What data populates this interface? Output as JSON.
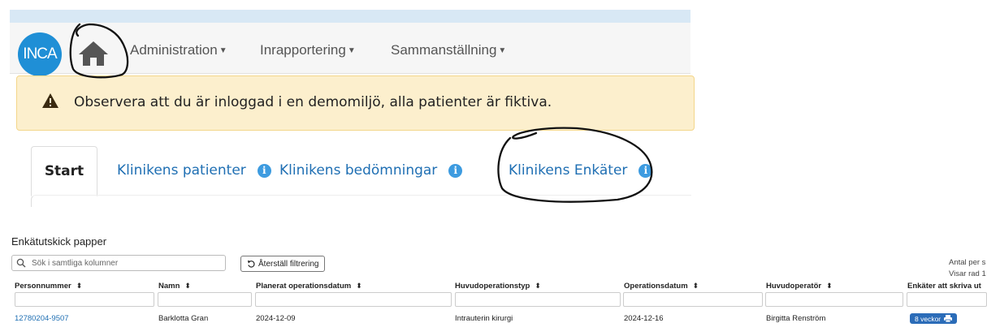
{
  "nav": {
    "logo_text": "INCA",
    "items": [
      {
        "label": "Administration"
      },
      {
        "label": "Inrapportering"
      },
      {
        "label": "Sammanställning"
      }
    ]
  },
  "alert": {
    "text": "Observera att du är inloggad i en demomiljö, alla patienter är fiktiva."
  },
  "tabs": [
    {
      "label": "Start"
    },
    {
      "label": "Klinikens patienter"
    },
    {
      "label": "Klinikens bedömningar"
    },
    {
      "label": "Klinikens Enkäter"
    }
  ],
  "panel": {
    "title": "Enkätutskick papper",
    "search_placeholder": "Sök i samtliga kolumner",
    "reset_label": "Återställ filtrering",
    "per_page_text": "Antal per s",
    "showing_text": "Visar rad 1"
  },
  "table": {
    "columns": [
      {
        "label": "Personnummer"
      },
      {
        "label": "Namn"
      },
      {
        "label": "Planerat operationsdatum"
      },
      {
        "label": "Huvudoperationstyp"
      },
      {
        "label": "Operationsdatum"
      },
      {
        "label": "Huvudoperatör"
      },
      {
        "label": "Enkäter att skriva ut"
      }
    ],
    "sort_glyph": "⬍",
    "rows": [
      {
        "personnummer": "12780204-9507",
        "namn": "Barklotta Gran",
        "planerat": "2024-12-09",
        "typ": "Intrauterin kirurgi",
        "opdatum": "2024-12-16",
        "operator": "Birgitta Renström",
        "enkat": "8 veckor"
      }
    ]
  },
  "colors": {
    "accent": "#1f8fd6",
    "link": "#1f6fb3",
    "alert_bg": "#fcefcd",
    "badge": "#2b6cb8"
  }
}
